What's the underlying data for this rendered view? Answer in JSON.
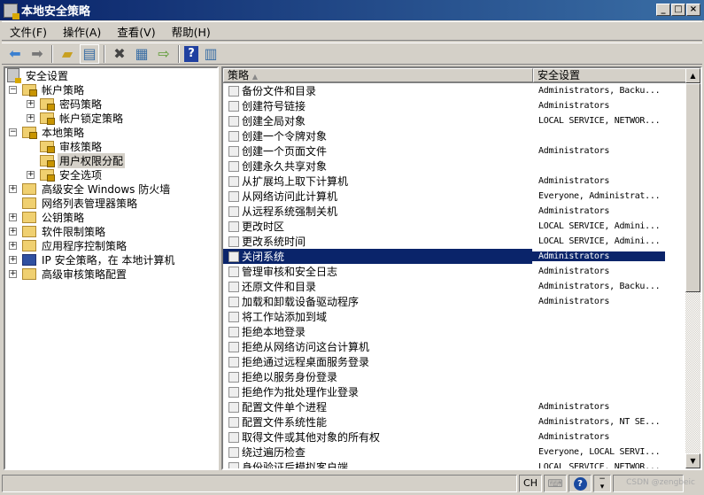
{
  "window": {
    "title": "本地安全策略",
    "buttons": [
      "_",
      "□",
      "×"
    ]
  },
  "menu": [
    "文件(F)",
    "操作(A)",
    "查看(V)",
    "帮助(H)"
  ],
  "tree": [
    {
      "label": "安全设置",
      "level": 0,
      "expander": "",
      "icon": "server-lock"
    },
    {
      "label": "帐户策略",
      "level": 0,
      "expander": "−",
      "icon": "folder-lock"
    },
    {
      "label": "密码策略",
      "level": 1,
      "expander": "+",
      "icon": "folder-lock"
    },
    {
      "label": "帐户锁定策略",
      "level": 1,
      "expander": "+",
      "icon": "folder-lock"
    },
    {
      "label": "本地策略",
      "level": 0,
      "expander": "−",
      "icon": "folder-lock"
    },
    {
      "label": "审核策略",
      "level": 1,
      "expander": "",
      "icon": "folder-lock"
    },
    {
      "label": "用户权限分配",
      "level": 1,
      "expander": "",
      "icon": "folder-lock",
      "selected": true
    },
    {
      "label": "安全选项",
      "level": 1,
      "expander": "+",
      "icon": "folder-lock"
    },
    {
      "label": "高级安全 Windows 防火墙",
      "level": 0,
      "expander": "+",
      "icon": "folder"
    },
    {
      "label": "网络列表管理器策略",
      "level": 0,
      "expander": "",
      "icon": "folder"
    },
    {
      "label": "公钥策略",
      "level": 0,
      "expander": "+",
      "icon": "folder"
    },
    {
      "label": "软件限制策略",
      "level": 0,
      "expander": "+",
      "icon": "folder"
    },
    {
      "label": "应用程序控制策略",
      "level": 0,
      "expander": "+",
      "icon": "folder"
    },
    {
      "label": "IP 安全策略，在 本地计算机",
      "level": 0,
      "expander": "+",
      "icon": "ipsec"
    },
    {
      "label": "高级审核策略配置",
      "level": 0,
      "expander": "+",
      "icon": "folder"
    }
  ],
  "columns": {
    "policy": "策略",
    "setting": "安全设置"
  },
  "rows": [
    {
      "policy": "备份文件和目录",
      "setting": "Administrators, Backu..."
    },
    {
      "policy": "创建符号链接",
      "setting": "Administrators"
    },
    {
      "policy": "创建全局对象",
      "setting": "LOCAL SERVICE, NETWOR..."
    },
    {
      "policy": "创建一个令牌对象",
      "setting": ""
    },
    {
      "policy": "创建一个页面文件",
      "setting": "Administrators"
    },
    {
      "policy": "创建永久共享对象",
      "setting": ""
    },
    {
      "policy": "从扩展坞上取下计算机",
      "setting": "Administrators"
    },
    {
      "policy": "从网络访问此计算机",
      "setting": "Everyone, Administrat..."
    },
    {
      "policy": "从远程系统强制关机",
      "setting": "Administrators"
    },
    {
      "policy": "更改时区",
      "setting": "LOCAL SERVICE, Admini..."
    },
    {
      "policy": "更改系统时间",
      "setting": "LOCAL SERVICE, Admini..."
    },
    {
      "policy": "关闭系统",
      "setting": "Administrators",
      "selected": true
    },
    {
      "policy": "管理审核和安全日志",
      "setting": "Administrators"
    },
    {
      "policy": "还原文件和目录",
      "setting": "Administrators, Backu..."
    },
    {
      "policy": "加载和卸载设备驱动程序",
      "setting": "Administrators"
    },
    {
      "policy": "将工作站添加到域",
      "setting": ""
    },
    {
      "policy": "拒绝本地登录",
      "setting": ""
    },
    {
      "policy": "拒绝从网络访问这台计算机",
      "setting": ""
    },
    {
      "policy": "拒绝通过远程桌面服务登录",
      "setting": ""
    },
    {
      "policy": "拒绝以服务身份登录",
      "setting": ""
    },
    {
      "policy": "拒绝作为批处理作业登录",
      "setting": ""
    },
    {
      "policy": "配置文件单个进程",
      "setting": "Administrators"
    },
    {
      "policy": "配置文件系统性能",
      "setting": "Administrators, NT SE..."
    },
    {
      "policy": "取得文件或其他对象的所有权",
      "setting": "Administrators"
    },
    {
      "policy": "绕过遍历检查",
      "setting": "Everyone, LOCAL SERVI..."
    },
    {
      "policy": "身份验证后模拟客户端",
      "setting": "LOCAL SERVICE, NETWOR..."
    }
  ],
  "status": {
    "lang": "CH",
    "watermark": "CSDN @zengbeic"
  }
}
